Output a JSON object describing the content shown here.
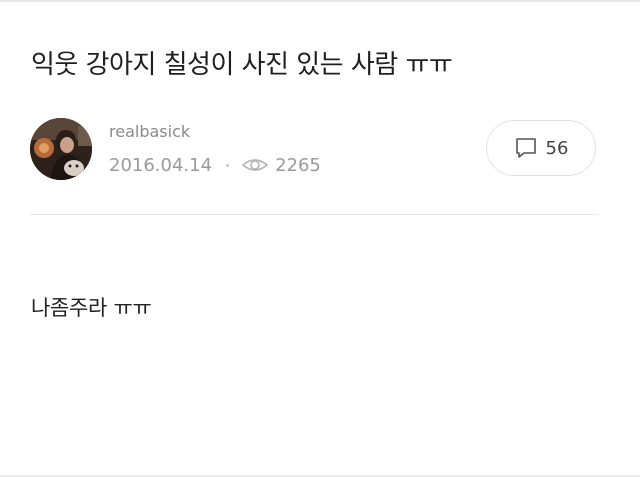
{
  "post": {
    "title": "익웃 강아지 칠성이 사진 있는 사람 ㅠㅠ",
    "body": "나좀주라 ㅠㅠ"
  },
  "author": {
    "name": "realbasick"
  },
  "meta": {
    "date": "2016.04.14",
    "views": "2265"
  },
  "comments": {
    "count": "56"
  },
  "icons": {
    "views": "eye-icon",
    "comments": "speech-bubble-icon"
  },
  "colors": {
    "meta_text": "#9a9a9a",
    "title_text": "#1f1f1f",
    "divider": "#e6e6e6"
  }
}
